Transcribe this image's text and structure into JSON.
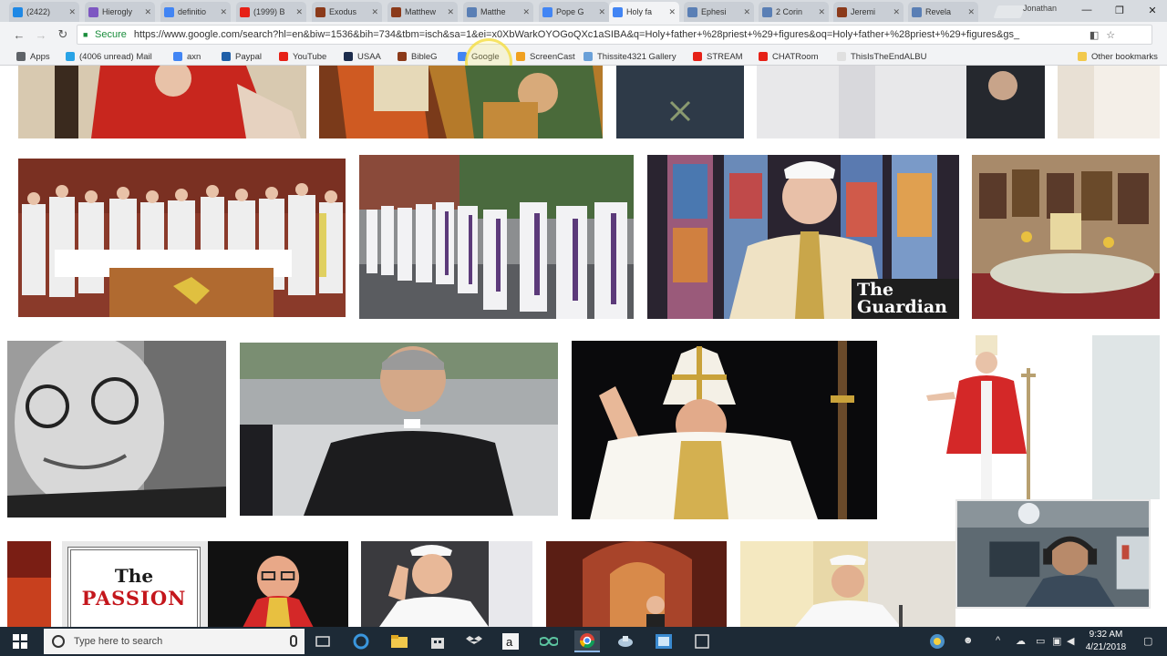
{
  "tabs": [
    {
      "label": "(2422)",
      "color": "#1e88e5"
    },
    {
      "label": "Hierogly",
      "color": "#7e57c2"
    },
    {
      "label": "definitio",
      "color": "#4285f4"
    },
    {
      "label": "(1999) B",
      "color": "#e62117"
    },
    {
      "label": "Exodus",
      "color": "#8b3a1a"
    },
    {
      "label": "Matthew",
      "color": "#8b3a1a"
    },
    {
      "label": "Matthe",
      "color": "#5a7fb5"
    },
    {
      "label": "Pope G",
      "color": "#4285f4"
    },
    {
      "label": "Holy fa",
      "color": "#4285f4",
      "active": true
    },
    {
      "label": "Ephesi",
      "color": "#5a7fb5"
    },
    {
      "label": "2 Corin",
      "color": "#5a7fb5"
    },
    {
      "label": "Jeremi",
      "color": "#8b3a1a"
    },
    {
      "label": "Revela",
      "color": "#5a7fb5"
    }
  ],
  "window_user": "Jonathan",
  "toolbar": {
    "secure_label": "Secure",
    "url": "https://www.google.com/search?hl=en&biw=1536&bih=734&tbm=isch&sa=1&ei=x0XbWarkOYOGoQXc1aSIBA&q=Holy+father+%28priest+%29+figures&oq=Holy+father+%28priest+%29+figures&gs_"
  },
  "bookmarks": [
    {
      "label": "Apps",
      "color": "#5f6368"
    },
    {
      "label": "(4006 unread) Mail",
      "color": "#29a3e6"
    },
    {
      "label": "axn",
      "color": "#4285f4"
    },
    {
      "label": "Paypal",
      "color": "#1f5fa8"
    },
    {
      "label": "YouTube",
      "color": "#e62117"
    },
    {
      "label": "USAA",
      "color": "#1c2c4c"
    },
    {
      "label": "BibleG",
      "color": "#8b3a1a"
    },
    {
      "label": "Google",
      "color": "#4285f4"
    },
    {
      "label": "ScreenCast",
      "color": "#f0a020"
    },
    {
      "label": "Thissite4321 Gallery",
      "color": "#6aa0d8"
    },
    {
      "label": "STREAM",
      "color": "#e62117"
    },
    {
      "label": "CHATRoom",
      "color": "#e62117"
    },
    {
      "label": "ThisIsTheEndALBU",
      "color": "#e0e0e0"
    },
    {
      "label": "Other bookmarks",
      "color": "#f2c94c"
    }
  ],
  "images": {
    "guardian_logo": "The Guardian",
    "passion_the": "The",
    "passion_word": "PASSION"
  },
  "taskbar": {
    "search_placeholder": "Type here to search",
    "time": "9:32 AM",
    "date": "4/21/2018"
  }
}
